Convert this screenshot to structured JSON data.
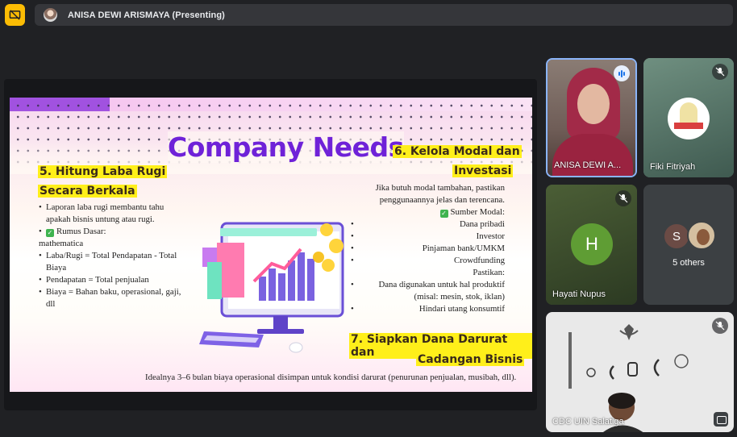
{
  "topbar": {
    "presenter_label": "ANISA DEWI ARISMAYA (Presenting)"
  },
  "slide": {
    "title": "Company Needs",
    "section5": {
      "heading_line1": "5. Hitung Laba Rugi",
      "heading_line2": "Secara Berkala",
      "items": [
        {
          "bullet": "•",
          "text": "Laporan laba rugi membantu tahu"
        },
        {
          "bullet": "",
          "text": "apakah bisnis untung atau rugi."
        },
        {
          "bullet": "•",
          "check": true,
          "text": "Rumus Dasar:"
        },
        {
          "bullet": "",
          "text": "mathematica"
        },
        {
          "bullet": "•",
          "text": "Laba/Rugi = Total Pendapatan - Total"
        },
        {
          "bullet": "",
          "text": "Biaya"
        },
        {
          "bullet": "•",
          "text": "Pendapatan = Total penjualan"
        },
        {
          "bullet": "•",
          "text": "Biaya = Bahan baku, operasional, gaji,"
        },
        {
          "bullet": "",
          "text": "dll"
        }
      ]
    },
    "section6": {
      "heading_line1": "6. Kelola Modal dan",
      "heading_line2": "Investasi",
      "items": [
        {
          "bullet": "",
          "text": "Jika butuh modal tambahan, pastikan"
        },
        {
          "bullet": "",
          "text": "penggunaannya jelas dan terencana."
        },
        {
          "bullet": "",
          "check": true,
          "text": "Sumber Modal:"
        },
        {
          "bullet": "•",
          "text": "Dana pribadi"
        },
        {
          "bullet": "•",
          "text": "Investor"
        },
        {
          "bullet": "•",
          "text": "Pinjaman bank/UMKM"
        },
        {
          "bullet": "•",
          "text": "Crowdfunding"
        },
        {
          "bullet": "",
          "text": "Pastikan:"
        },
        {
          "bullet": "•",
          "text": "Dana digunakan untuk hal produktif"
        },
        {
          "bullet": "",
          "text": "(misal: mesin, stok, iklan)"
        },
        {
          "bullet": "•",
          "text": "Hindari utang konsumtif"
        }
      ]
    },
    "section7": {
      "heading_line1": "7. Siapkan Dana Darurat dan",
      "heading_line2": "Cadangan Bisnis",
      "footer": "Idealnya 3–6 bulan biaya operasional disimpan untuk kondisi darurat (penurunan penjualan, musibah, dll)."
    }
  },
  "participants": {
    "tile1": {
      "name": "ANISA DEWI A..."
    },
    "tile2": {
      "name": "Fiki Fitriyah"
    },
    "tile3": {
      "name": "Hayati Nupus",
      "initial": "H"
    },
    "tile4": {
      "initial": "S",
      "others_label": "5 others"
    },
    "tile5": {
      "name": "CDC UIN Salatiga"
    }
  },
  "colors": {
    "present_button": "#fbbc04",
    "slide_title": "#6f22d8",
    "highlight": "#ffef1a",
    "active_speaker_border": "#8ab4f8"
  }
}
